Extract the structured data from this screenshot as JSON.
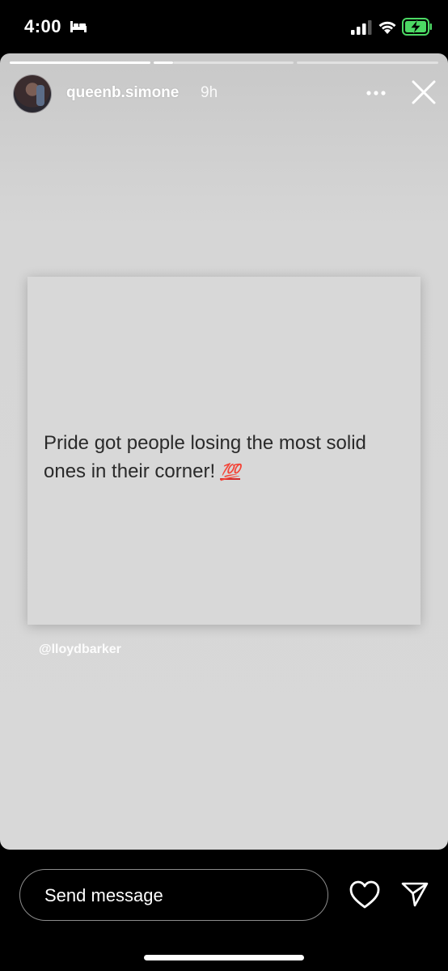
{
  "status_bar": {
    "time": "4:00",
    "icons": [
      "bed-icon",
      "signal-icon",
      "wifi-icon",
      "battery-charging-icon"
    ],
    "battery_color": "#4cd964"
  },
  "story": {
    "progress": {
      "total": 3,
      "current": 2
    },
    "username": "queenb.simone",
    "age": "9h",
    "tweet_text": "Pride got people losing the most solid ones in their corner!",
    "emoji": "💯",
    "mention": "@lloydbarker"
  },
  "bottom_bar": {
    "message_placeholder": "Send message",
    "icons": [
      "heart-icon",
      "send-icon"
    ]
  }
}
